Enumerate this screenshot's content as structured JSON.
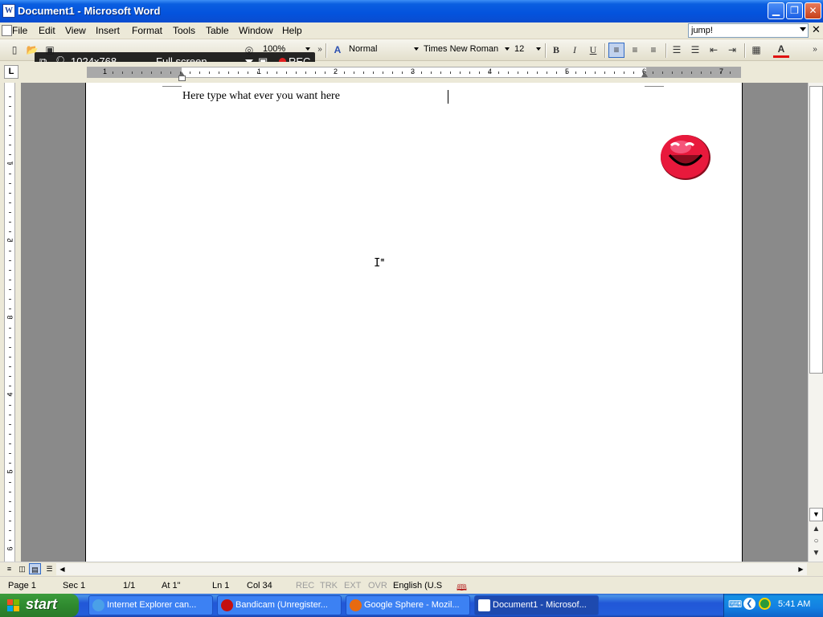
{
  "window": {
    "title": "Document1 - Microsoft Word",
    "minimize_icon": "minimize-icon",
    "restore_icon": "restore-icon",
    "close_icon": "close-icon"
  },
  "menubar": {
    "items": [
      "File",
      "Edit",
      "View",
      "Insert",
      "Format",
      "Tools",
      "Table",
      "Window",
      "Help"
    ],
    "help_box_value": "jump!"
  },
  "toolbar": {
    "zoom": "100%",
    "style": "Normal",
    "font": "Times New Roman",
    "font_size": "12",
    "bold": "B",
    "italic": "I",
    "underline": "U",
    "font_color_letter": "A",
    "font_color": "#e01010"
  },
  "bandicam": {
    "resolution": "1024x768",
    "mode": "Full screen",
    "rec": "REC"
  },
  "ruler": {
    "tab_selector": "L",
    "h_numbers": [
      "1",
      "1",
      "2",
      "3",
      "4",
      "5",
      "6",
      "7"
    ],
    "v_numbers": [
      "1",
      "2",
      "3",
      "4",
      "5",
      "6"
    ]
  },
  "document": {
    "text": "Here type what ever you want here",
    "image": "smiley-face-clipart"
  },
  "status": {
    "page": "Page 1",
    "sec": "Sec 1",
    "pages": "1/1",
    "at": "At 1\"",
    "ln": "Ln 1",
    "col": "Col 34",
    "rec": "REC",
    "trk": "TRK",
    "ext": "EXT",
    "ovr": "OVR",
    "language": "English (U.S"
  },
  "taskbar": {
    "start": "start",
    "tasks": [
      {
        "label": "Internet Explorer can...",
        "icon": "ie-icon"
      },
      {
        "label": "Bandicam (Unregister...",
        "icon": "bandicam-icon"
      },
      {
        "label": "Google Sphere - Mozil...",
        "icon": "firefox-icon"
      },
      {
        "label": "Document1 - Microsof...",
        "icon": "word-icon"
      }
    ],
    "clock": "5:41 AM"
  },
  "colors": {
    "titlebar": "#0453dd",
    "start_button": "#2f8a2f",
    "taskbar": "#245edb",
    "smiley": "#e8193c"
  }
}
